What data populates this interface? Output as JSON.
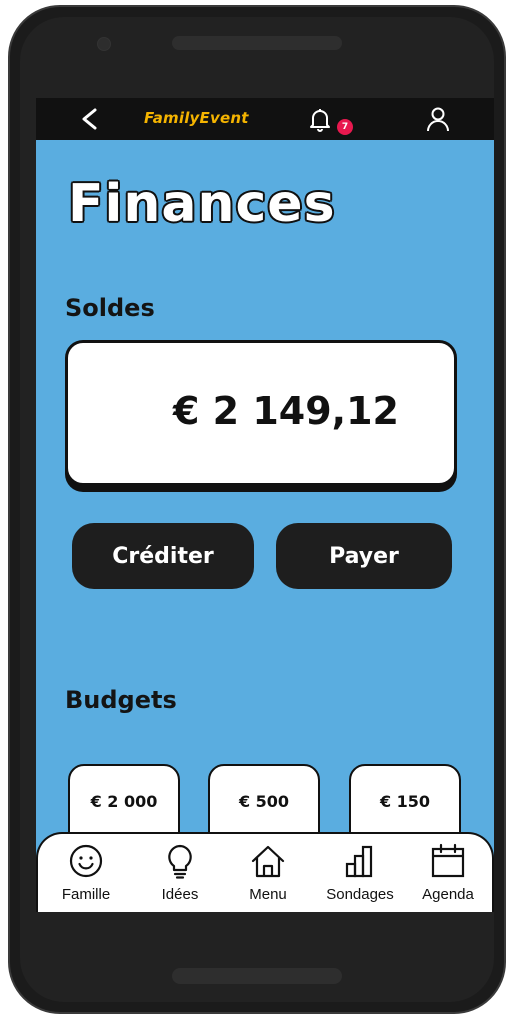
{
  "header": {
    "brand": "FamilyEvent",
    "notification_count": "7"
  },
  "page": {
    "title": "Finances"
  },
  "balance": {
    "section_title": "Soldes",
    "amount": "€ 2 149,12"
  },
  "actions": {
    "credit_label": "Créditer",
    "pay_label": "Payer"
  },
  "budgets": {
    "section_title": "Budgets",
    "items": [
      {
        "amount": "€ 2 000"
      },
      {
        "amount": "€ 500"
      },
      {
        "amount": "€ 150"
      }
    ]
  },
  "tabbar": {
    "items": [
      {
        "label": "Famille",
        "icon": "smiley-icon"
      },
      {
        "label": "Idées",
        "icon": "lightbulb-icon"
      },
      {
        "label": "Menu",
        "icon": "home-icon"
      },
      {
        "label": "Sondages",
        "icon": "bar-chart-icon"
      },
      {
        "label": "Agenda",
        "icon": "calendar-icon"
      }
    ]
  },
  "colors": {
    "background": "#5aade0",
    "topbar": "#111111",
    "brand": "#f5b400",
    "badge": "#e8194f",
    "button": "#1e1e1e"
  }
}
